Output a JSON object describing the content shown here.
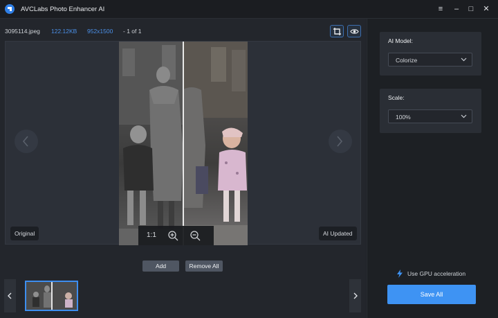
{
  "window": {
    "title": "AVCLabs Photo Enhancer AI",
    "controls": [
      "≡",
      "–",
      "□",
      "✕"
    ]
  },
  "file_info": {
    "name": "3095114.jpeg",
    "size": "122.12KB",
    "dimensions": "952x1500",
    "page": "- 1 of 1"
  },
  "viewer": {
    "original_label": "Original",
    "updated_label": "AI Updated",
    "zoom_ratio": "1:1"
  },
  "actions": {
    "add_label": "Add",
    "remove_all_label": "Remove All"
  },
  "settings": {
    "ai_model_label": "AI Model:",
    "ai_model_value": "Colorize",
    "scale_label": "Scale:",
    "scale_value": "100%",
    "gpu_label": "Use GPU acceleration",
    "save_all_label": "Save All"
  },
  "colors": {
    "accent": "#3e93f3",
    "link_blue": "#4b90e8",
    "panel": "#2a2e35",
    "background": "#1e2126"
  },
  "icons": [
    "app-logo-icon",
    "menu-icon",
    "minimize-icon",
    "maximize-icon",
    "close-icon",
    "crop-icon",
    "eye-icon",
    "chevron-left-icon",
    "chevron-right-icon",
    "zoom-in-icon",
    "zoom-out-icon",
    "chevron-down-icon",
    "lightning-icon"
  ]
}
